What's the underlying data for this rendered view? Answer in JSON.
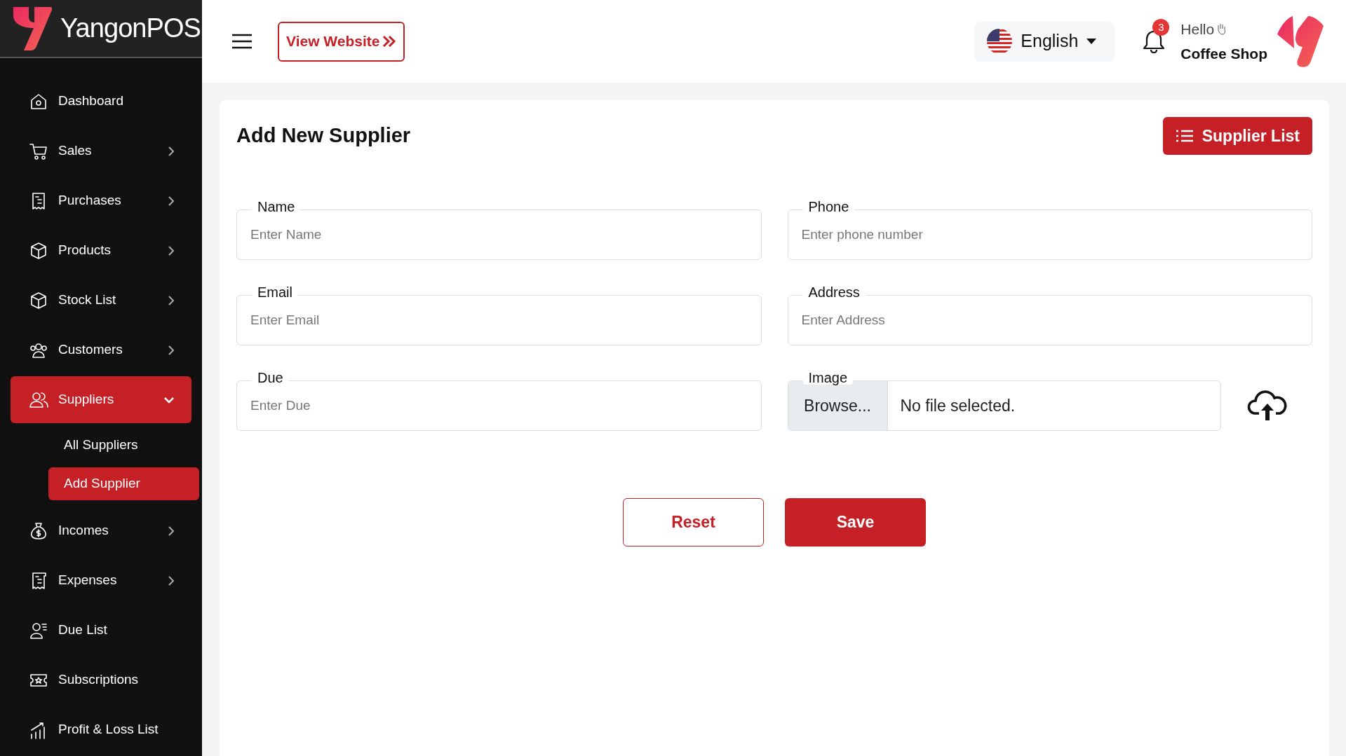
{
  "brand": {
    "name": "YangonPOS"
  },
  "header": {
    "view_website": "View Website",
    "language": "English",
    "notifications": "3",
    "greeting": "Hello",
    "user": "Coffee Shop"
  },
  "sidebar": {
    "items": [
      {
        "label": "Dashboard",
        "selected": false
      },
      {
        "label": "Sales",
        "expanded": false,
        "selected": false
      },
      {
        "label": "Purchases",
        "expanded": false,
        "selected": false
      },
      {
        "label": "Products",
        "expanded": false,
        "selected": false
      },
      {
        "label": "Stock List",
        "expanded": false,
        "selected": false
      },
      {
        "label": "Customers",
        "expanded": false,
        "selected": false
      },
      {
        "label": "Suppliers",
        "expanded": true,
        "selected": true,
        "children": [
          {
            "label": "All Suppliers",
            "selected": false
          },
          {
            "label": "Add Supplier",
            "selected": true
          }
        ]
      },
      {
        "label": "Incomes",
        "expanded": false,
        "selected": false
      },
      {
        "label": "Expenses",
        "expanded": false,
        "selected": false
      },
      {
        "label": "Due List",
        "selected": false
      },
      {
        "label": "Subscriptions",
        "selected": false
      },
      {
        "label": "Profit & Loss List",
        "selected": false
      }
    ]
  },
  "page": {
    "title": "Add New Supplier",
    "list_button": "Supplier List",
    "fields": [
      {
        "kind": "text",
        "label": "Name",
        "placeholder": "Enter Name"
      },
      {
        "kind": "text",
        "label": "Phone",
        "placeholder": "Enter phone number"
      },
      {
        "kind": "text",
        "label": "Email",
        "placeholder": "Enter Email"
      },
      {
        "kind": "text",
        "label": "Address",
        "placeholder": "Enter Address"
      },
      {
        "kind": "text",
        "label": "Due",
        "placeholder": "Enter Due"
      },
      {
        "kind": "file",
        "label": "Image",
        "button": "Browse...",
        "status": "No file selected."
      }
    ],
    "buttons": [
      {
        "kind": "outline",
        "label": "Reset"
      },
      {
        "kind": "solid",
        "label": "Save"
      }
    ]
  }
}
